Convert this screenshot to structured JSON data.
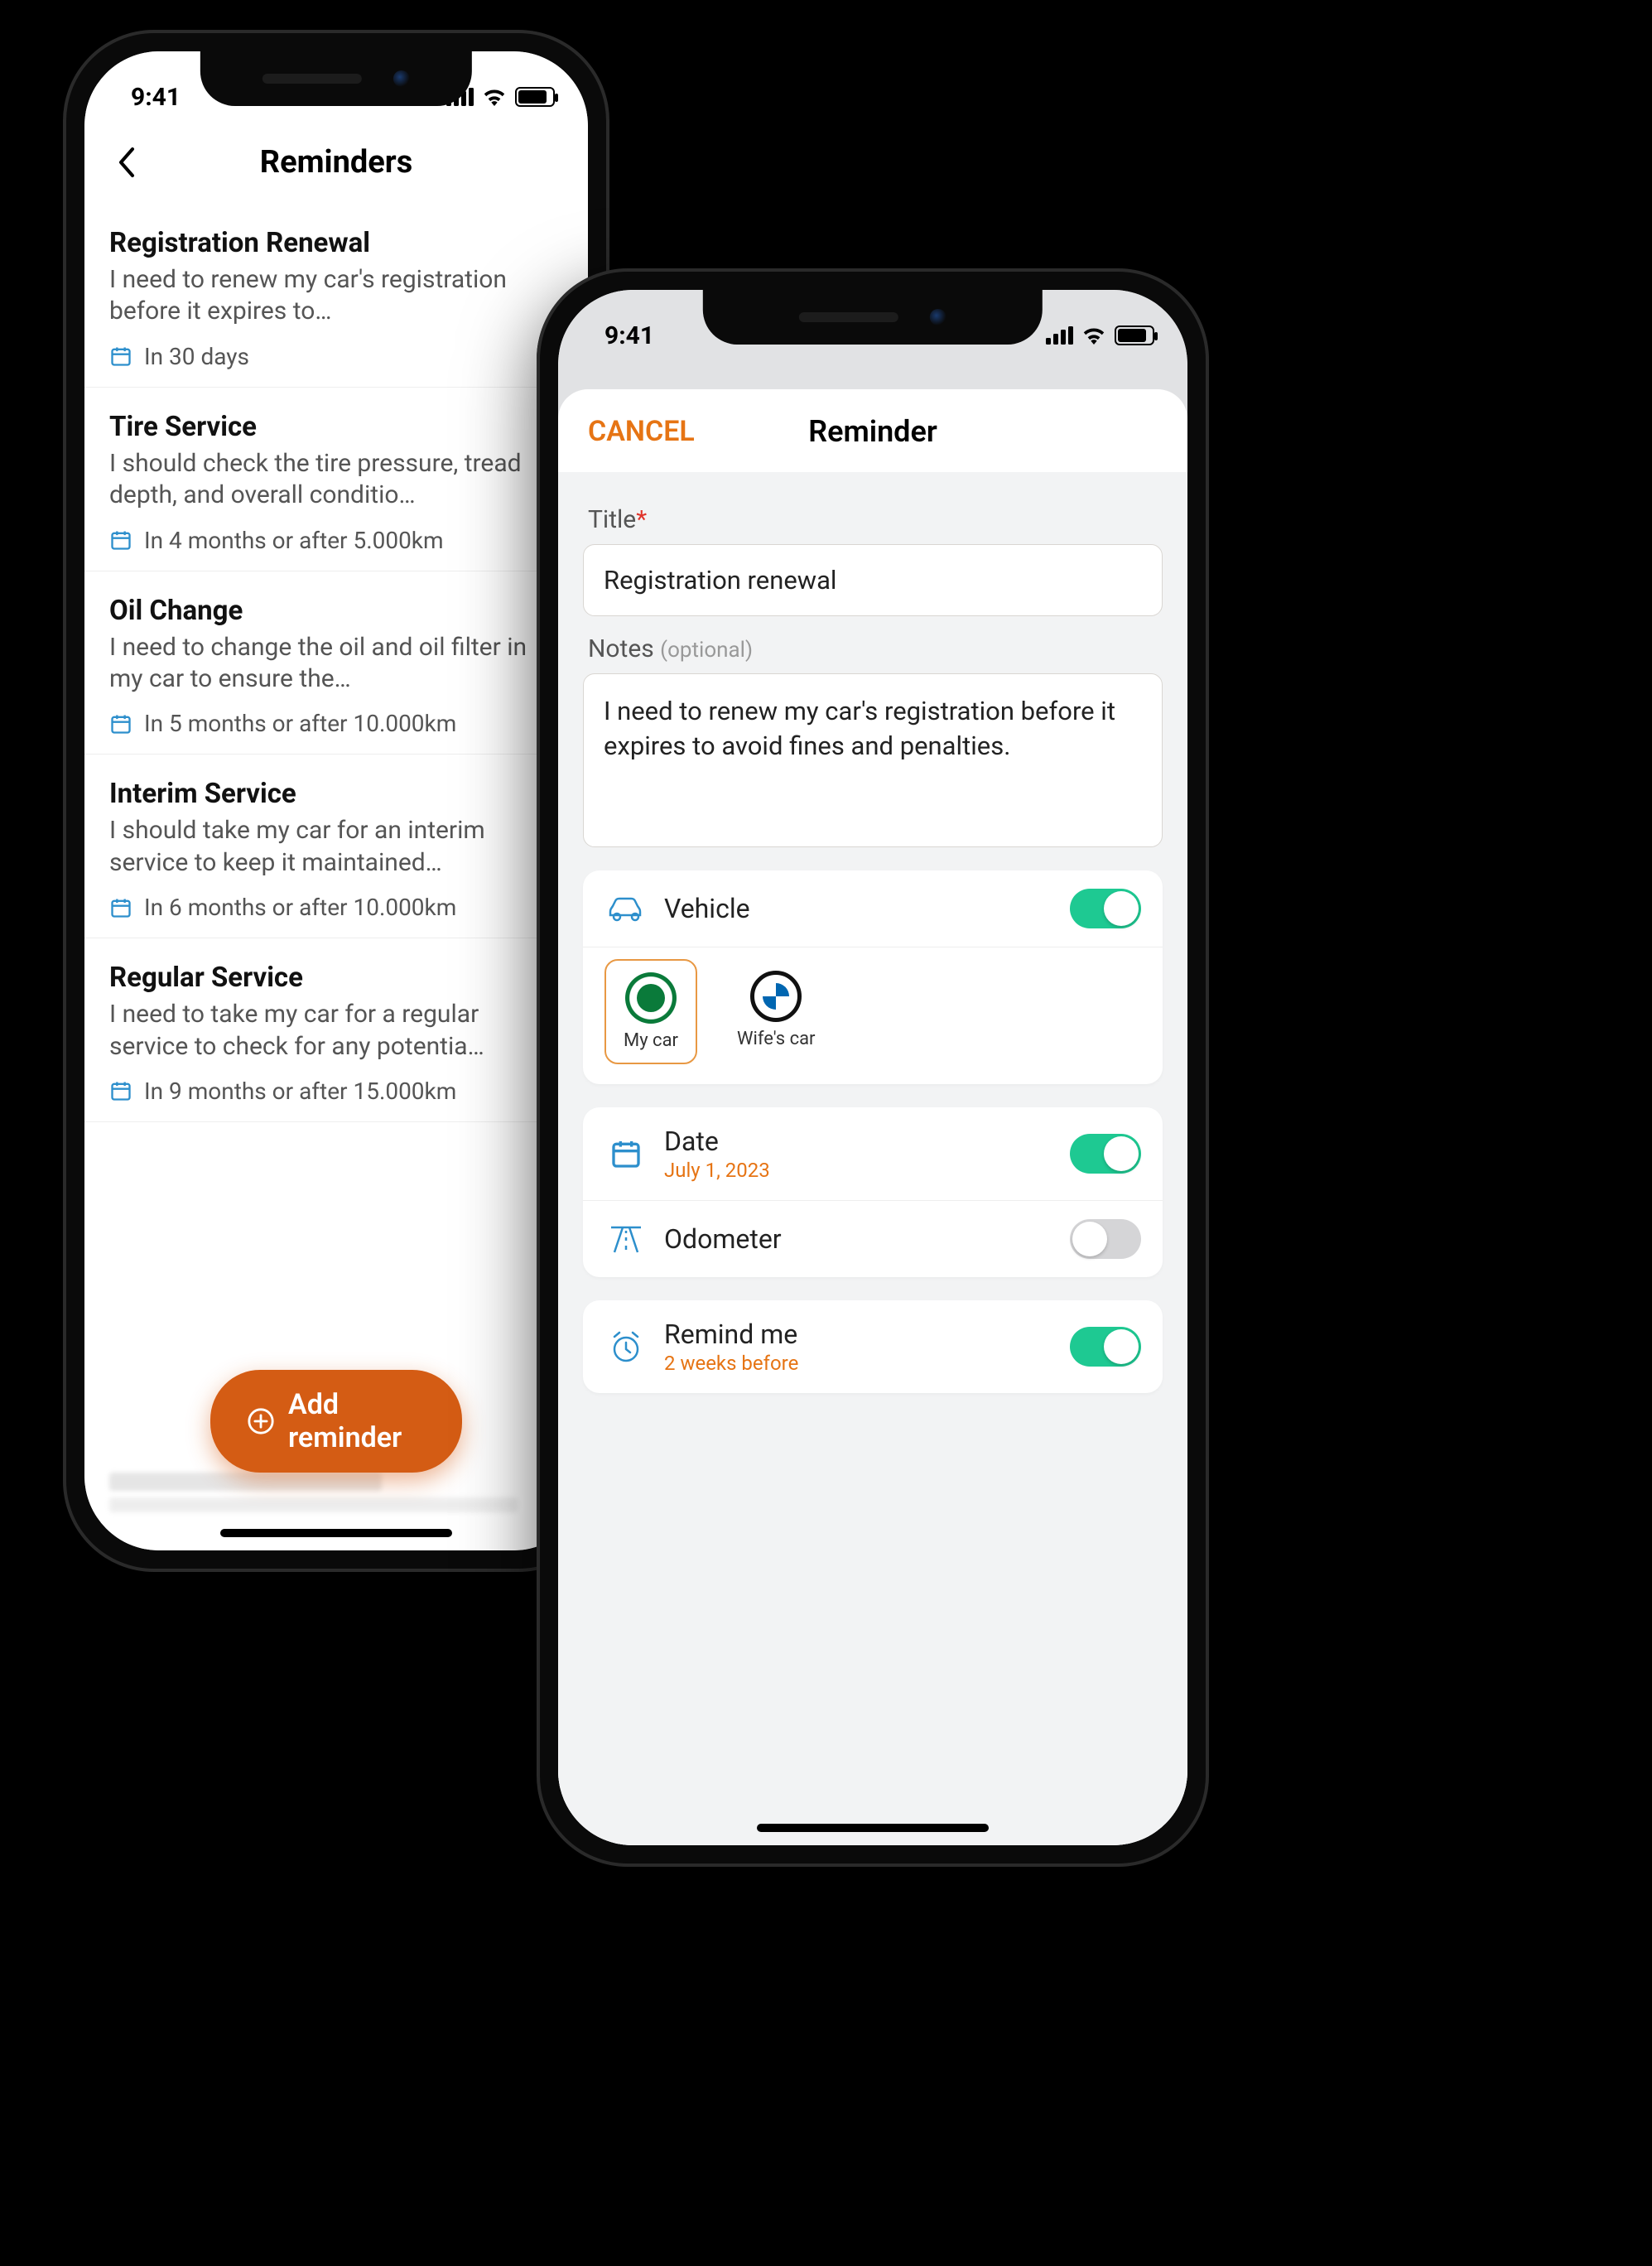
{
  "status_time": "9:41",
  "phone1": {
    "header_title": "Reminders",
    "reminders": [
      {
        "title": "Registration Renewal",
        "desc": "I need to renew my car's registration before it expires to…",
        "meta": "In 30 days"
      },
      {
        "title": "Tire Service",
        "desc": "I should check the tire pressure, tread depth, and overall conditio…",
        "meta": "In 4 months or after 5.000km"
      },
      {
        "title": "Oil Change",
        "desc": "I need to change the oil and oil filter in my car to ensure the…",
        "meta": "In 5 months or after 10.000km"
      },
      {
        "title": "Interim Service",
        "desc": "I should take my car for an interim service to keep it maintained…",
        "meta": "In 6 months or after 10.000km"
      },
      {
        "title": "Regular Service",
        "desc": "I need to take my car for a regular service to check for any potentia…",
        "meta": "In 9 months or after 15.000km"
      }
    ],
    "add_button": "Add reminder"
  },
  "phone2": {
    "cancel": "CANCEL",
    "header_title": "Reminder",
    "title_label": "Title",
    "required_mark": "*",
    "title_value": "Registration renewal",
    "notes_label": "Notes",
    "notes_hint": "(optional)",
    "notes_value": "I need to renew my car's registration before it expires to avoid fines and penalties.",
    "vehicle_section": {
      "label": "Vehicle",
      "toggle_on": true,
      "options": [
        {
          "label": "My car",
          "brand": "skoda",
          "selected": true
        },
        {
          "label": "Wife's car",
          "brand": "bmw",
          "selected": false
        }
      ]
    },
    "date_section": {
      "label": "Date",
      "value": "July 1, 2023",
      "toggle_on": true
    },
    "odometer_section": {
      "label": "Odometer",
      "toggle_on": false
    },
    "remind_section": {
      "label": "Remind me",
      "value": "2 weeks before",
      "toggle_on": true
    }
  }
}
